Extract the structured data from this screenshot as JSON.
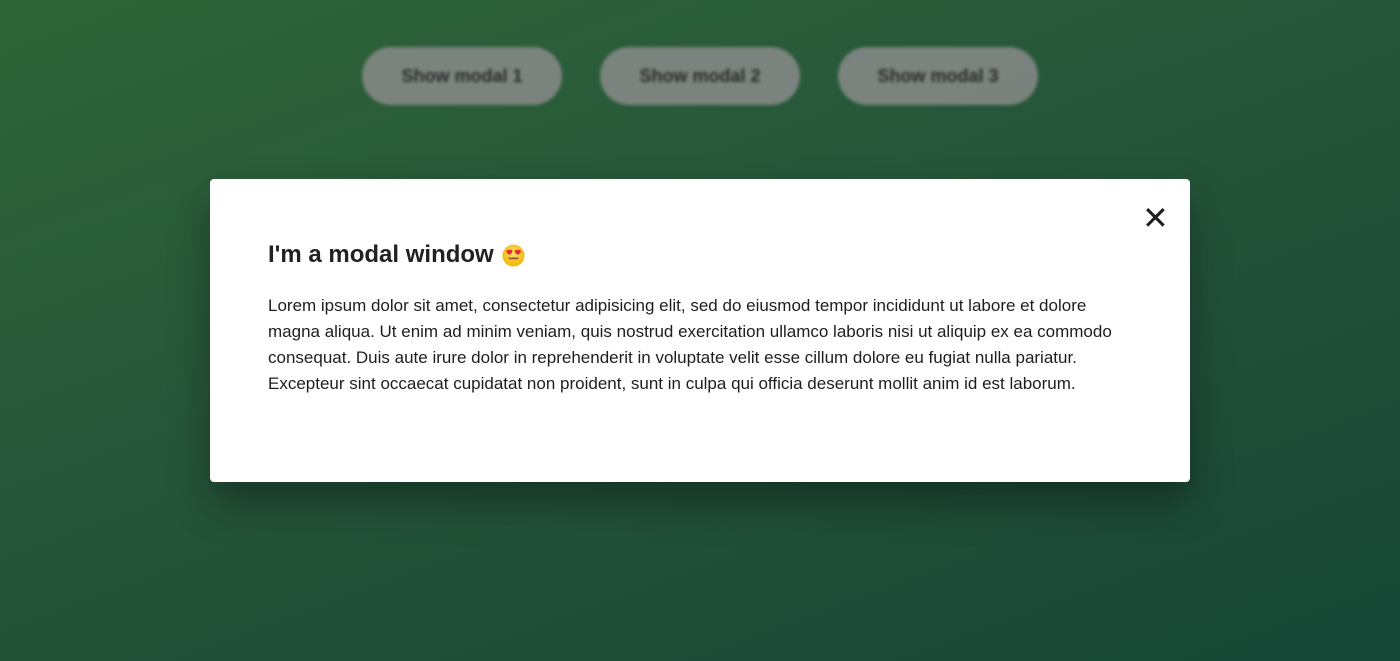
{
  "buttons": [
    {
      "label": "Show modal 1"
    },
    {
      "label": "Show modal 2"
    },
    {
      "label": "Show modal 3"
    }
  ],
  "modal": {
    "title": "I'm a modal window",
    "title_icon": "heart-eyes-emoji-icon",
    "close_icon": "close-icon",
    "close_glyph": "✕",
    "body": "Lorem ipsum dolor sit amet, consectetur adipisicing elit, sed do eiusmod tempor incididunt ut labore et dolore magna aliqua. Ut enim ad minim veniam, quis nostrud exercitation ullamco laboris nisi ut aliquip ex ea commodo consequat. Duis aute irure dolor in reprehenderit in voluptate velit esse cillum dolore eu fugiat nulla pariatur. Excepteur sint occaecat cupidatat non proident, sunt in culpa qui officia deserunt mollit anim id est laborum."
  },
  "colors": {
    "background_start": "#2f6537",
    "background_end": "#154636",
    "modal_background": "#ffffff",
    "button_background": "#8c8c8c"
  }
}
